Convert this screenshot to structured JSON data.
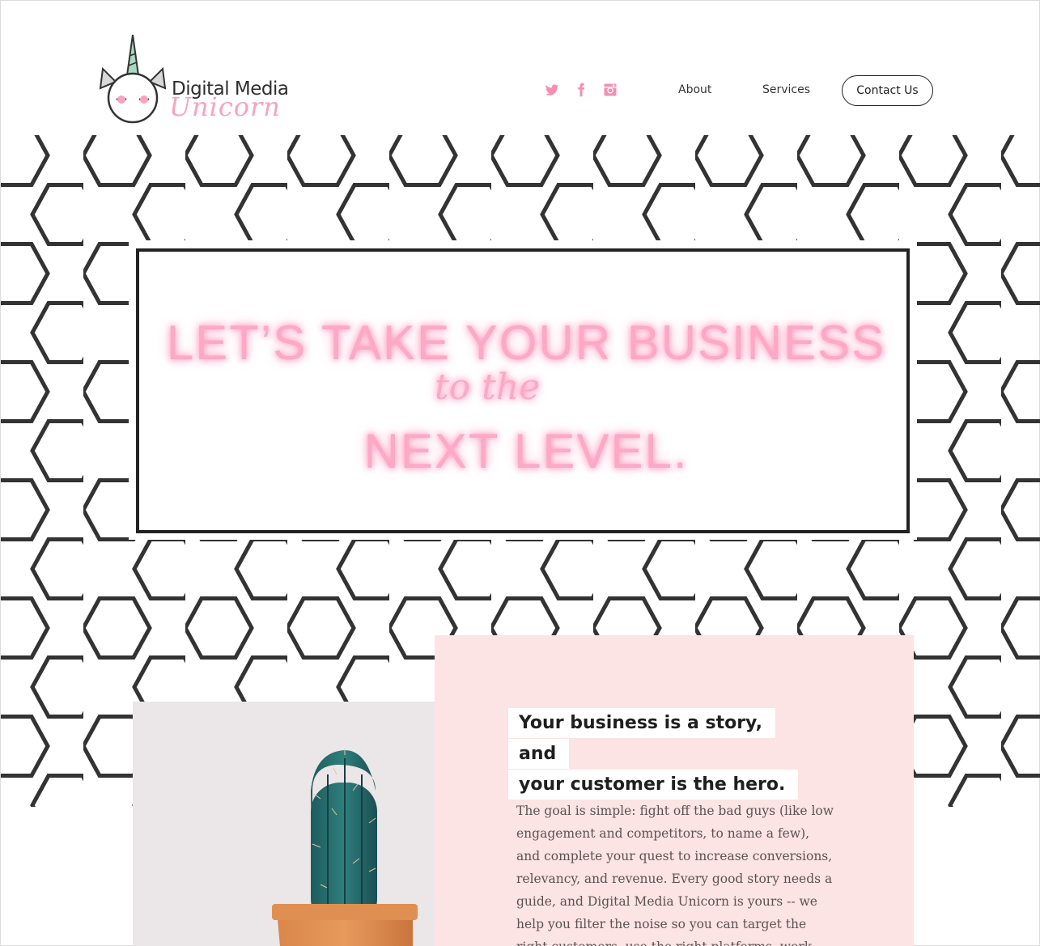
{
  "brand": {
    "name_line1": "Digital Media",
    "name_line2": "Unicorn"
  },
  "social": [
    {
      "icon": "twitter-icon",
      "color": "#f48fb1"
    },
    {
      "icon": "facebook-icon",
      "color": "#f48fb1"
    },
    {
      "icon": "instagram-icon",
      "color": "#f48fb1"
    }
  ],
  "nav": {
    "about": "About",
    "services": "Services",
    "contact": "Contact Us"
  },
  "hero": {
    "line1": "LET’S TAKE YOUR BUSINESS",
    "line2": "to the",
    "line3": "NEXT LEVEL."
  },
  "story": {
    "heading_line1": "Your business is a story, and",
    "heading_line2": "your customer is the hero.",
    "body": "The goal is simple: fight off the bad guys (like low engagement and competitors, to name a few), and complete your quest to increase conversions, relevancy, and revenue. Every good story needs a guide, and Digital Media Unicorn is yours -- we help you filter the noise so you can target the right customers, use the right platforms, work with the"
  },
  "colors": {
    "accent_pink": "#f48fb1",
    "neon_pink": "#fca9c4",
    "card_pink": "#fce3e4",
    "hex_stroke": "#333333"
  }
}
